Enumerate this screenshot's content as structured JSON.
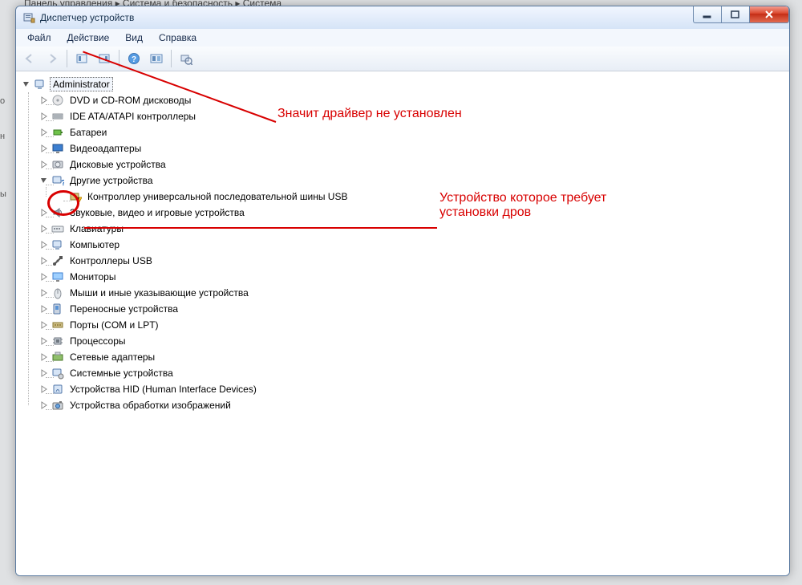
{
  "breadcrumb_fragment": "Панель управления   ▸   Система и безопасность   ▸   Система",
  "window": {
    "title": "Диспетчер устройств"
  },
  "menu": {
    "file": "Файл",
    "action": "Действие",
    "view": "Вид",
    "help": "Справка"
  },
  "tree": {
    "root": "Administrator",
    "items": [
      {
        "icon": "disc",
        "label": "DVD и CD-ROM дисководы"
      },
      {
        "icon": "ide",
        "label": "IDE ATA/ATAPI контроллеры"
      },
      {
        "icon": "battery",
        "label": "Батареи"
      },
      {
        "icon": "display",
        "label": "Видеоадаптеры"
      },
      {
        "icon": "hdd",
        "label": "Дисковые устройства"
      },
      {
        "icon": "unknown",
        "label": "Другие устройства",
        "expanded": true,
        "children": [
          {
            "icon": "warn-chip",
            "label": "Контроллер универсальной последовательной шины USB"
          }
        ]
      },
      {
        "icon": "sound",
        "label": "Звуковые, видео и игровые устройства"
      },
      {
        "icon": "keyboard",
        "label": "Клавиатуры"
      },
      {
        "icon": "computer",
        "label": "Компьютер"
      },
      {
        "icon": "usb",
        "label": "Контроллеры USB"
      },
      {
        "icon": "monitor",
        "label": "Мониторы"
      },
      {
        "icon": "mouse",
        "label": "Мыши и иные указывающие устройства"
      },
      {
        "icon": "portable",
        "label": "Переносные устройства"
      },
      {
        "icon": "port",
        "label": "Порты (COM и LPT)"
      },
      {
        "icon": "cpu",
        "label": "Процессоры"
      },
      {
        "icon": "network",
        "label": "Сетевые адаптеры"
      },
      {
        "icon": "system",
        "label": "Системные устройства"
      },
      {
        "icon": "hid",
        "label": "Устройства HID (Human Interface Devices)"
      },
      {
        "icon": "imaging",
        "label": "Устройства обработки изображений"
      }
    ]
  },
  "annotations": {
    "a1": "Значит драйвер не установлен",
    "a2_line1": "Устройство которое требует",
    "a2_line2": "установки дров"
  }
}
